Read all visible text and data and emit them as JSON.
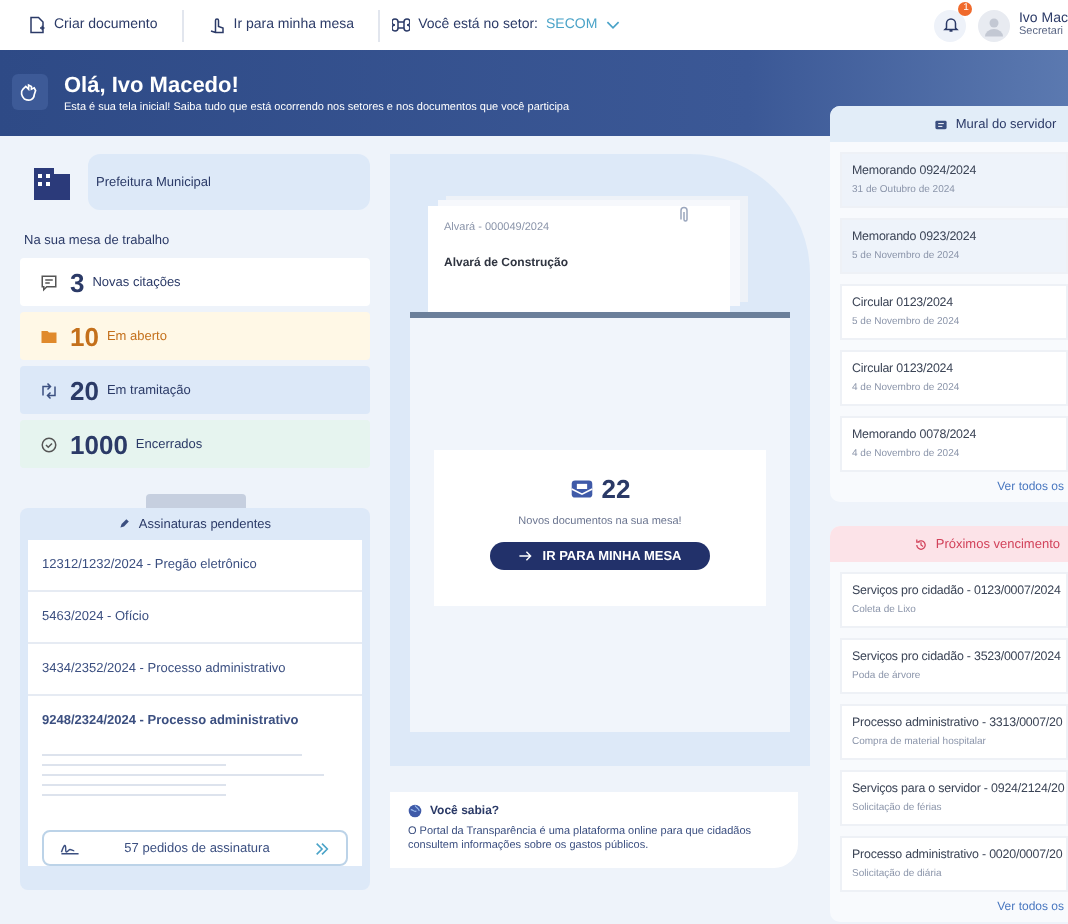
{
  "topbar": {
    "actions": [
      {
        "label": "Criar documento",
        "kind": "create"
      },
      {
        "label": "Ir para minha mesa",
        "kind": "desk"
      }
    ],
    "sector_label": "Você está no setor:",
    "sector": "SECOM",
    "notification_count": "1",
    "user": {
      "name": "Ivo Mac",
      "role": "Secretari"
    }
  },
  "banner": {
    "title": "Olá, Ivo Macedo!",
    "subtitle": "Esta é sua tela inicial! Saiba tudo que está ocorrendo nos setores e nos documentos que você participa"
  },
  "organization": "Prefeitura Municipal",
  "desk": {
    "title": "Na sua mesa de trabalho",
    "stats": [
      {
        "count": "3",
        "label": "Novas citações",
        "kind": "citations"
      },
      {
        "count": "10",
        "label": "Em aberto",
        "kind": "open"
      },
      {
        "count": "20",
        "label": "Em tramitação",
        "kind": "transit"
      },
      {
        "count": "1000",
        "label": "Encerrados",
        "kind": "closed"
      }
    ]
  },
  "pending": {
    "title": "Assinaturas pendentes",
    "items": [
      {
        "text": "12312/1232/2024 - Pregão eletrônico",
        "selected": false
      },
      {
        "text": "5463/2024 - Ofício",
        "selected": false
      },
      {
        "text": "3434/2352/2024 - Processo administrativo",
        "selected": false
      },
      {
        "text": "9248/2324/2024 - Processo administrativo",
        "selected": true
      }
    ],
    "button": "57 pedidos de assinatura"
  },
  "inbox": {
    "document": {
      "code": "Alvará - 000049/2024",
      "title": "Alvará de Construção"
    },
    "count": "22",
    "caption": "Novos documentos na sua mesa!",
    "button": "IR PARA MINHA MESA"
  },
  "tip": {
    "title": "Você sabia?",
    "text": "O Portal da Transparência é uma plataforma online para que cidadãos consultem informações sobre os gastos públicos."
  },
  "mural": {
    "title": "Mural do servidor",
    "items": [
      {
        "title": "Memorando 0924/2024",
        "date": "31 de Outubro de 2024",
        "selected": true
      },
      {
        "title": "Memorando 0923/2024",
        "date": "5 de Novembro de 2024",
        "selected": true
      },
      {
        "title": "Circular 0123/2024",
        "date": "5 de Novembro de 2024",
        "selected": false
      },
      {
        "title": "Circular 0123/2024",
        "date": "4 de Novembro de 2024",
        "selected": false
      },
      {
        "title": "Memorando 0078/2024",
        "date": "4 de Novembro de 2024",
        "selected": false
      }
    ],
    "link": "Ver todos os"
  },
  "deadlines": {
    "title": "Próximos vencimento",
    "items": [
      {
        "title": "Serviços pro cidadão - 0123/0007/2024",
        "detail": "Coleta de Lixo"
      },
      {
        "title": "Serviços pro cidadão - 3523/0007/2024",
        "detail": "Poda de árvore"
      },
      {
        "title": "Processo administrativo - 3313/0007/20",
        "detail": "Compra de material hospitalar"
      },
      {
        "title": "Serviços para o servidor - 0924/2124/20",
        "detail": "Solicitação de férias"
      },
      {
        "title": "Processo administrativo - 0020/0007/20",
        "detail": "Solicitação de diária"
      }
    ],
    "link": "Ver todos os"
  }
}
